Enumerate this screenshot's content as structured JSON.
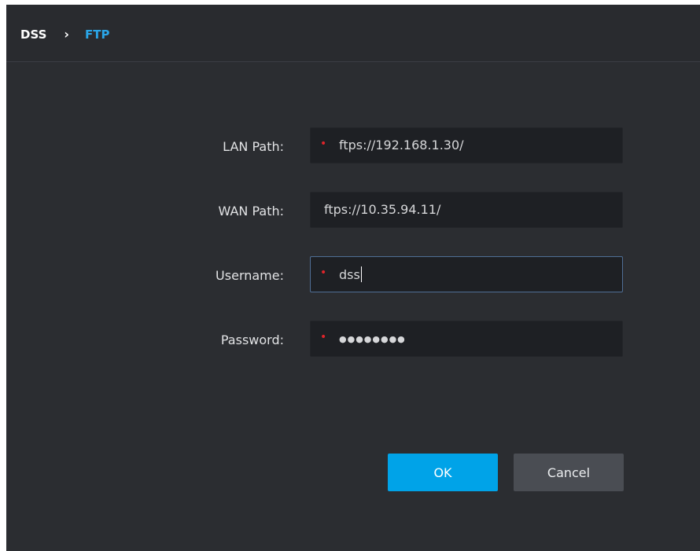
{
  "breadcrumb": {
    "root": "DSS",
    "separator": "›",
    "current": "FTP"
  },
  "form": {
    "lan_path": {
      "label": "LAN Path:",
      "value": "ftps://192.168.1.30/",
      "required": true
    },
    "wan_path": {
      "label": "WAN Path:",
      "value": "ftps://10.35.94.11/",
      "required": false
    },
    "username": {
      "label": "Username:",
      "value": "dss",
      "required": true,
      "focused": true
    },
    "password": {
      "label": "Password:",
      "masked_value": "●●●●●●●●",
      "required": true
    },
    "required_marker": "•"
  },
  "buttons": {
    "ok_label": "OK",
    "cancel_label": "Cancel"
  },
  "colors": {
    "background": "#2b2d31",
    "input_background": "#1e2024",
    "accent": "#2aa6e8",
    "ok_button": "#00a3e8",
    "cancel_button": "#4a4d53",
    "required": "#e0242a"
  }
}
